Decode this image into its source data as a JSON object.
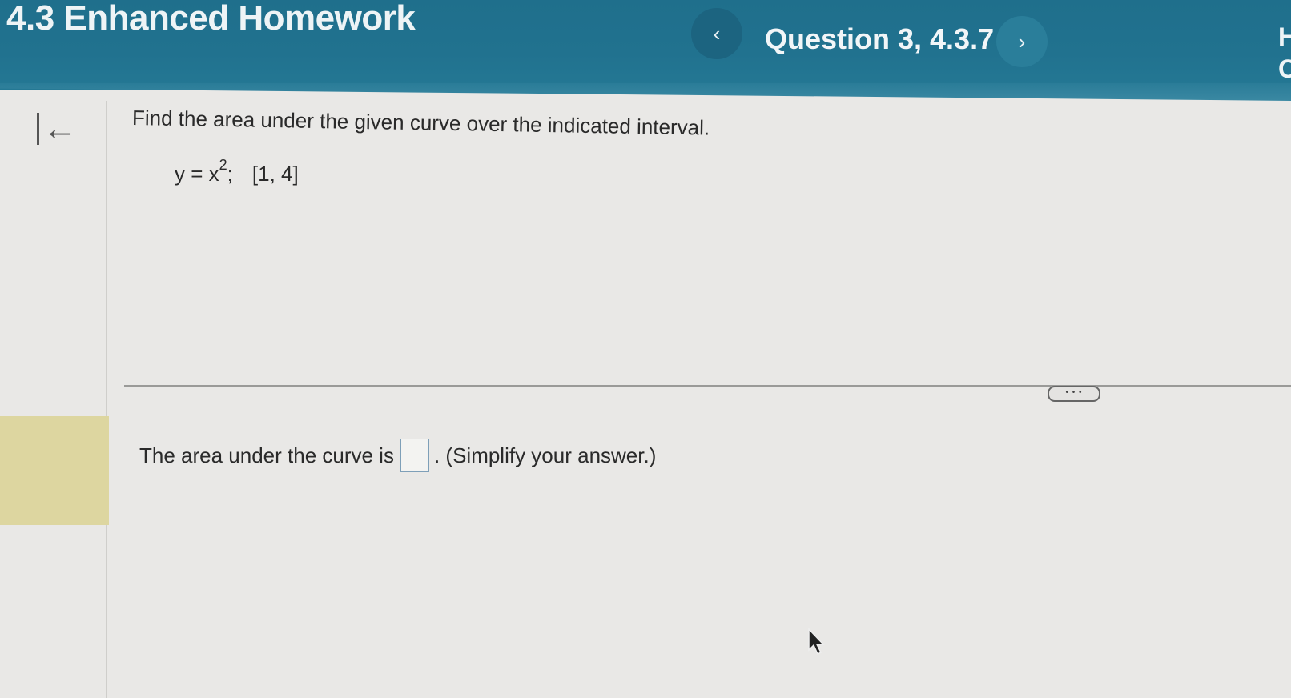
{
  "header": {
    "title": "4.3 Enhanced Homework",
    "question_label": "Question 3, 4.3.7",
    "prev_icon": "‹",
    "next_icon": "›",
    "corner_text_1": "H",
    "corner_text_2": "C"
  },
  "sidebar": {
    "back_icon": "←"
  },
  "question": {
    "prompt": "Find the area under the given curve over the indicated interval.",
    "equation_base": "y = x",
    "equation_exponent": "2",
    "equation_sep": ";",
    "interval": "[1, 4]"
  },
  "more_button_label": "• • •",
  "answer": {
    "prefix": "The area under the curve is",
    "suffix": ". (Simplify your answer.)",
    "value": ""
  },
  "colors": {
    "header_bg": "#21728f",
    "page_bg": "#e9e8e6",
    "highlight": "#ddd6a0"
  },
  "icons": [
    "chevron-left-icon",
    "chevron-right-icon",
    "back-to-start-icon",
    "more-icon",
    "mouse-cursor-icon"
  ]
}
